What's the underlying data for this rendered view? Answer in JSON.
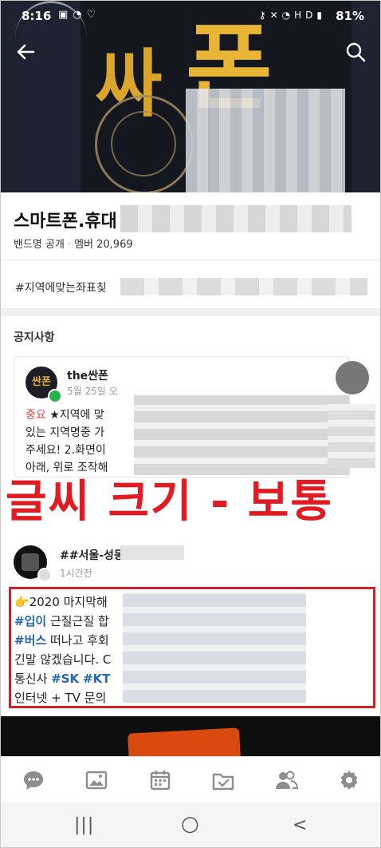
{
  "status_bar": {
    "time": "8:16",
    "left_icons": [
      "image-icon",
      "wifi-icon",
      "shield-icon"
    ],
    "right_icons": [
      "key-icon",
      "mute-icon",
      "wifi-icon",
      "hd-voice-icon",
      "signal-icon"
    ],
    "battery": "81%"
  },
  "header": {
    "back_icon": "arrow-left-icon",
    "search_icon": "search-icon",
    "cover_text_1": "싸",
    "cover_text_2": "폰"
  },
  "band": {
    "title": "스마트폰.휴대",
    "type": "밴드명 공개",
    "members": "멤버 20,969",
    "tag": "#지역에맞는좌표칮"
  },
  "notice": {
    "section_title": "공지사항",
    "card": {
      "avatar_text": "싼폰",
      "author": "the싼폰",
      "date": "5월 25일 오",
      "label": "중요",
      "line1": "★지역에 맞",
      "line2": "있는 지역명중 가",
      "line3": "주세요! 2.화면이",
      "line4": "아래, 위로 조작해"
    }
  },
  "overlay_caption": "글씨 크기 - 보통",
  "post": {
    "author": "##서울-성동",
    "time": "1시간전",
    "line1_emoji": "👉",
    "line1": "2020 마지막해",
    "line2_tag": "#입이",
    "line2": "근질근질 합",
    "line3_tag": "#버스",
    "line3": "떠나고 후회",
    "line4": "긴말 않겠습니다. C",
    "line5_prefix": "통신사",
    "line5_tag1": "#SK",
    "line5_tag2": "#KT",
    "line6": "인터넷 + TV 문의"
  },
  "bottom_nav": [
    "chat-icon",
    "photo-icon",
    "calendar-icon",
    "checklist-icon",
    "members-icon",
    "settings-icon"
  ],
  "system_nav": {
    "recents": "|||",
    "home": "○",
    "back": "<"
  },
  "colors": {
    "accent_red": "#e01b22",
    "hashtag_blue": "#2466b4",
    "notice_red": "#e04545",
    "badge_green": "#25b34b"
  }
}
